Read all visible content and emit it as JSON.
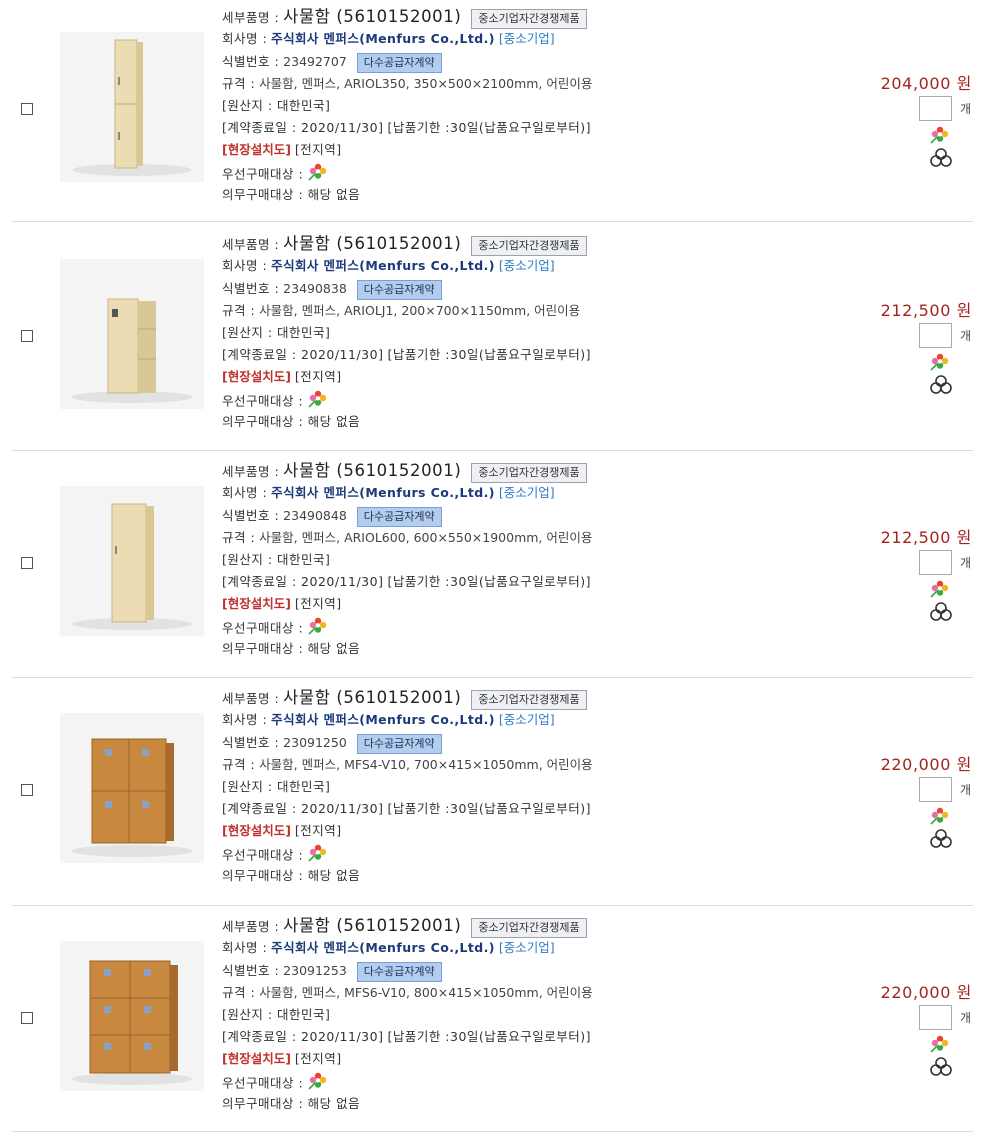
{
  "labels": {
    "item_name": "세부품명 :",
    "company": "회사명 :",
    "id_no": "식별번호 :",
    "spec": "규격 :",
    "origin": "[원산지 : 대한민국]",
    "contract_end": "[계약종료일 : 2020/11/30]",
    "delivery": "[납품기한 :30일(납품요구일로부터)]",
    "install": "[현장설치도]",
    "region": "[전지역]",
    "priority": "우선구매대상 :",
    "mandatory": "의무구매대상 : 해당 없음",
    "unit": "개"
  },
  "badges": {
    "sme_competition": "중소기업자간경쟁제품",
    "mas": "다수공급자계약"
  },
  "products": [
    {
      "name": "사물함 (5610152001)",
      "company": "주식회사 멘퍼스(Menfurs Co.,Ltd.)",
      "company_type": "[중소기업]",
      "id": "23492707",
      "spec": "사물함, 멘퍼스, ARIOL350, 350×500×2100mm, 어린이용",
      "price": "204,000 원",
      "image": "tall-narrow-light-wood-locker"
    },
    {
      "name": "사물함 (5610152001)",
      "company": "주식회사 멘퍼스(Menfurs Co.,Ltd.)",
      "company_type": "[중소기업]",
      "id": "23490838",
      "spec": "사물함, 멘퍼스, ARIOLJ1, 200×700×1150mm, 어린이용",
      "price": "212,500 원",
      "image": "short-open-shelf-locker"
    },
    {
      "name": "사물함 (5610152001)",
      "company": "주식회사 멘퍼스(Menfurs Co.,Ltd.)",
      "company_type": "[중소기업]",
      "id": "23490848",
      "spec": "사물함, 멘퍼스, ARIOL600, 600×550×1900mm, 어린이용",
      "price": "212,500 원",
      "image": "tall-wide-light-wood-locker"
    },
    {
      "name": "사물함 (5610152001)",
      "company": "주식회사 멘퍼스(Menfurs Co.,Ltd.)",
      "company_type": "[중소기업]",
      "id": "23091250",
      "spec": "사물함, 멘퍼스, MFS4-V10, 700×415×1050mm, 어린이용",
      "price": "220,000 원",
      "image": "four-door-oak-locker"
    },
    {
      "name": "사물함 (5610152001)",
      "company": "주식회사 멘퍼스(Menfurs Co.,Ltd.)",
      "company_type": "[중소기업]",
      "id": "23091253",
      "spec": "사물함, 멘퍼스, MFS6-V10, 800×415×1050mm, 어린이용",
      "price": "220,000 원",
      "image": "six-door-oak-locker"
    }
  ],
  "colors": {
    "price": "#a3241f",
    "company": "#1b3a7a",
    "install": "#c0312d",
    "badge_blue": "#b3cdef"
  }
}
